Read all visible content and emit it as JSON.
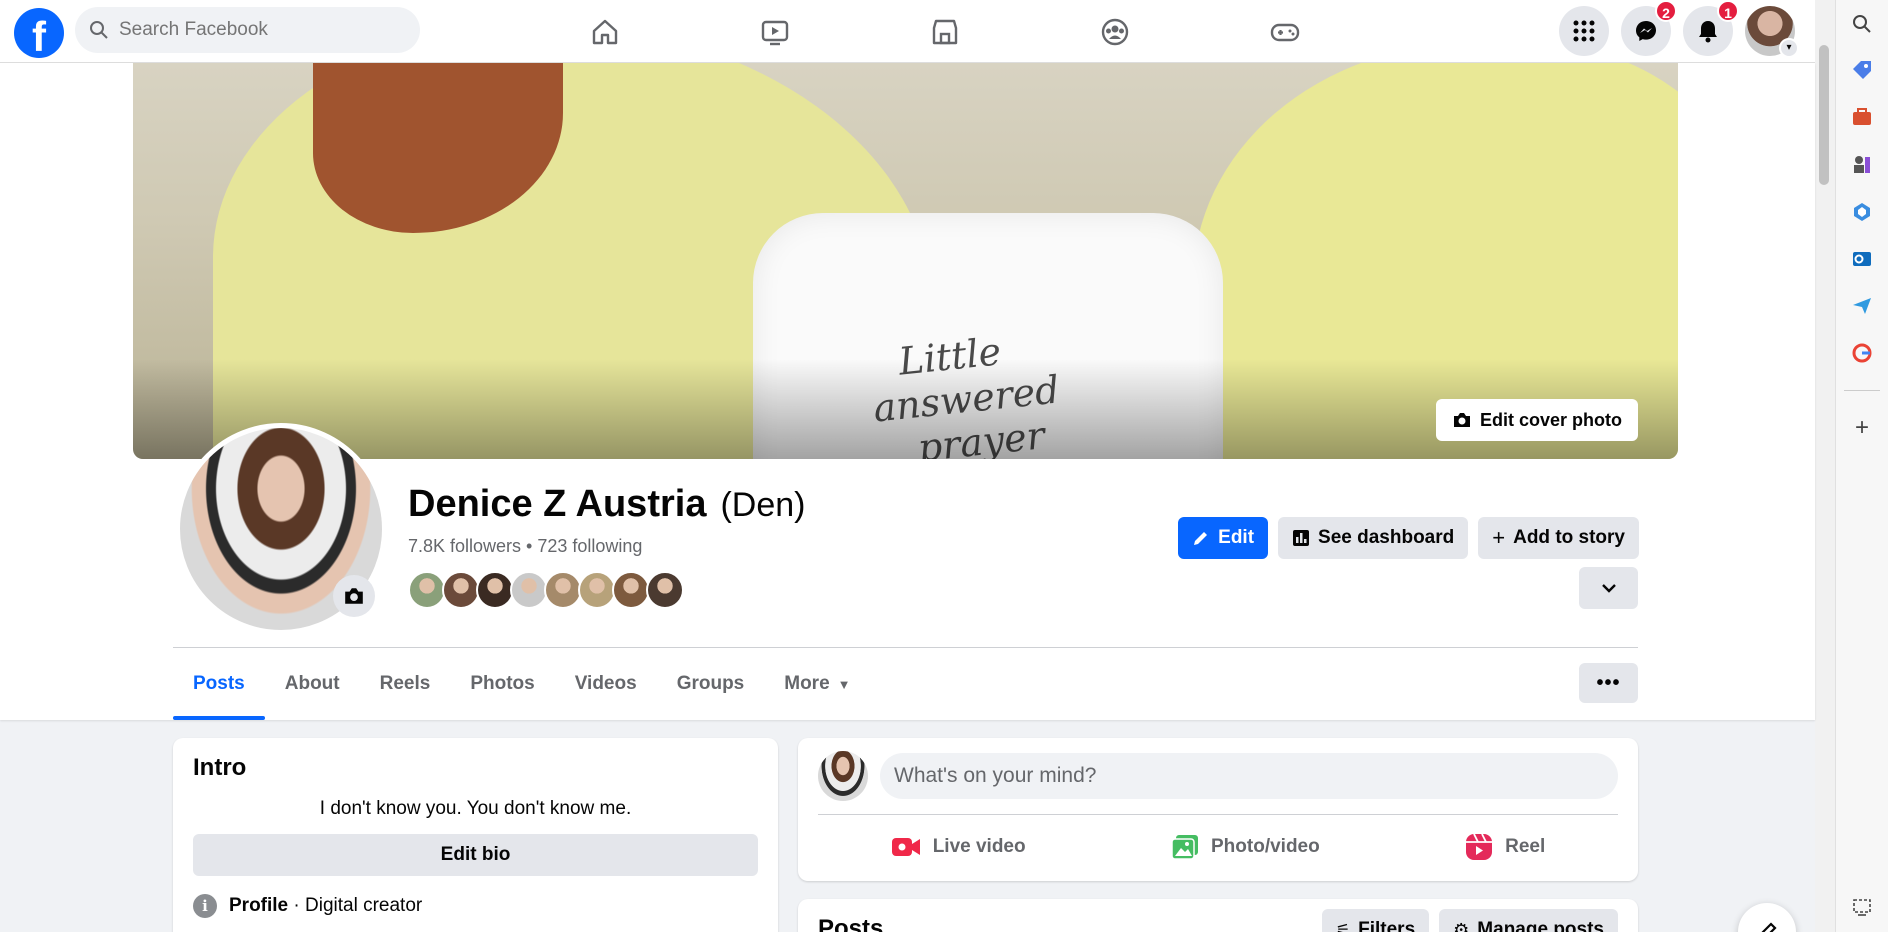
{
  "header": {
    "logo_letter": "f",
    "search_placeholder": "Search Facebook",
    "nav_icons": [
      "home-icon",
      "video-icon",
      "marketplace-icon",
      "groups-icon",
      "gaming-icon"
    ],
    "messenger_badge": "2",
    "notifications_badge": "1"
  },
  "cover": {
    "edit_label": "Edit cover photo",
    "onesie_text_line1": "Little",
    "onesie_text_line2": "answered",
    "onesie_text_line3": "prayer"
  },
  "profile": {
    "name": "Denice Z Austria",
    "nickname": "(Den)",
    "followers_line": "7.8K followers • 723 following",
    "friend_avatar_colors": [
      "#8aa07a",
      "#6b4a3a",
      "#3a2a22",
      "#c9c9c9",
      "#a58a6a",
      "#b7a27a",
      "#7d5a3e",
      "#4b3a30"
    ]
  },
  "actions": {
    "edit_label": "Edit",
    "dashboard_label": "See dashboard",
    "story_label": "Add to story"
  },
  "tabs": [
    {
      "label": "Posts"
    },
    {
      "label": "About"
    },
    {
      "label": "Reels"
    },
    {
      "label": "Photos"
    },
    {
      "label": "Videos"
    },
    {
      "label": "Groups"
    },
    {
      "label": "More"
    }
  ],
  "intro": {
    "title": "Intro",
    "bio": "I don't know you. You don't know me.",
    "edit_bio_label": "Edit bio",
    "profile_label": "Profile",
    "profile_category": " · Digital creator"
  },
  "composer": {
    "placeholder": "What's on your mind?",
    "live_label": "Live video",
    "photo_label": "Photo/video",
    "reel_label": "Reel"
  },
  "posts": {
    "title": "Posts",
    "filters_label": "Filters",
    "manage_label": "Manage posts"
  },
  "colors": {
    "brand_blue": "#0866ff",
    "badge_red": "#e41e3f"
  }
}
